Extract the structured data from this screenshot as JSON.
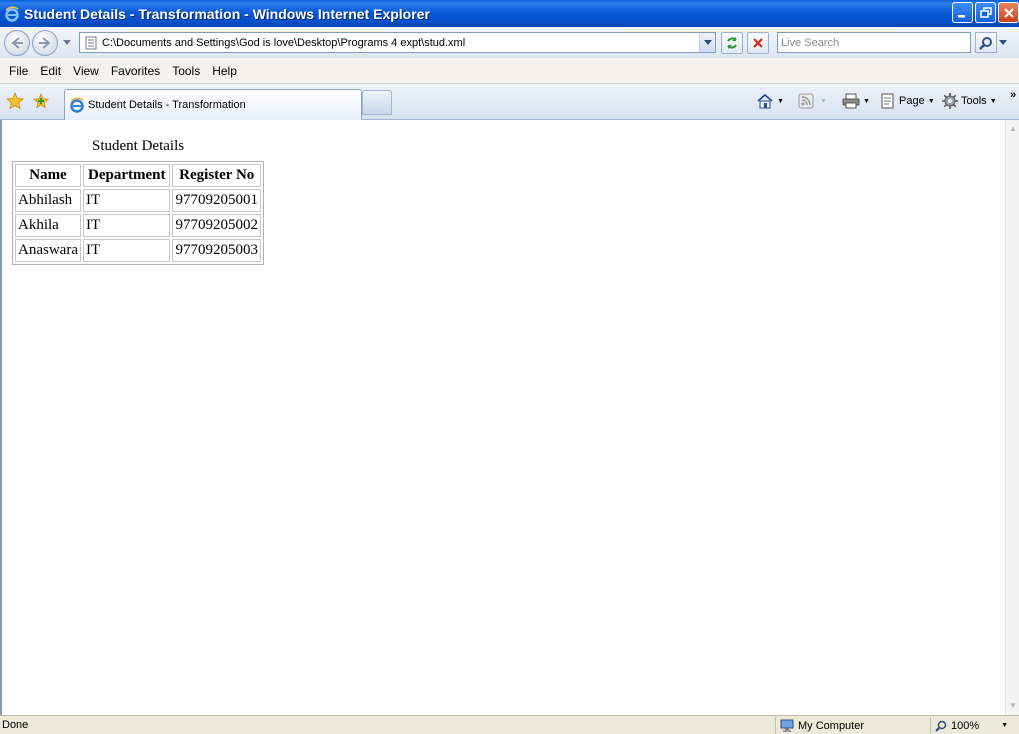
{
  "window": {
    "title": "Student Details - Transformation - Windows Internet Explorer"
  },
  "address_bar": {
    "url": "C:\\Documents and Settings\\God is love\\Desktop\\Programs 4 expt\\stud.xml"
  },
  "search": {
    "placeholder": "Live Search"
  },
  "menu": [
    "File",
    "Edit",
    "View",
    "Favorites",
    "Tools",
    "Help"
  ],
  "tabs": [
    {
      "label": "Student Details - Transformation"
    }
  ],
  "command_bar": {
    "page_label": "Page",
    "tools_label": "Tools"
  },
  "document": {
    "title": "Student Details",
    "table": {
      "headers": [
        "Name",
        "Department",
        "Register No"
      ],
      "rows": [
        [
          "Abhilash",
          "IT",
          "97709205001"
        ],
        [
          "Akhila",
          "IT",
          "97709205002"
        ],
        [
          "Anaswara",
          "IT",
          "97709205003"
        ]
      ]
    }
  },
  "status": {
    "text": "Done",
    "zone": "My Computer",
    "zoom": "100%"
  },
  "icons": {
    "app": "ie-logo-icon",
    "back": "back-arrow-icon",
    "forward": "forward-arrow-icon",
    "refresh": "refresh-icon",
    "stop": "stop-icon",
    "search": "magnifier-icon",
    "favorites": "star-icon",
    "add_favorite": "add-favorite-icon",
    "home": "home-icon",
    "feeds": "rss-feed-icon",
    "print": "printer-icon",
    "page": "page-icon",
    "tools": "gear-icon",
    "computer": "computer-icon",
    "zoom": "zoom-icon"
  },
  "colors": {
    "titlebar": "#0a58d6",
    "close_button": "#c8401c"
  }
}
